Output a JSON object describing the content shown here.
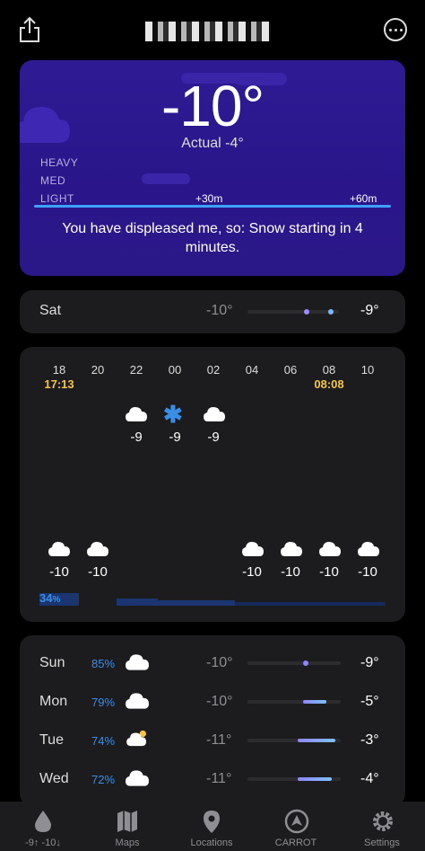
{
  "header": {
    "share_icon": "share-icon",
    "more_icon": "more-icon"
  },
  "hero": {
    "temperature": "-10°",
    "actual": "Actual -4°",
    "levels": [
      "HEAVY",
      "MED",
      "LIGHT"
    ],
    "ticks": [
      "+30m",
      "+60m"
    ],
    "message": "You have displeased me, so: Snow starting in 4 minutes.",
    "accent_color": "#3ea0ff",
    "background_color": "#2e1a93"
  },
  "today_row": {
    "day": "Sat",
    "low": "-10°",
    "high": "-9°"
  },
  "hourly": {
    "hours": [
      "18",
      "20",
      "22",
      "00",
      "02",
      "04",
      "06",
      "08",
      "10"
    ],
    "sunset": "17:13",
    "sunrise": "08:08",
    "temps": [
      "-10",
      "-10",
      "-9",
      "-9",
      "-9",
      "-10",
      "-10",
      "-10",
      "-10"
    ],
    "precip_chance": "34",
    "precip_unit": "%"
  },
  "daily": [
    {
      "day": "Sun",
      "pct": "85%",
      "low": "-10°",
      "high": "-9°",
      "icon": "cloud-icon"
    },
    {
      "day": "Mon",
      "pct": "79%",
      "low": "-10°",
      "high": "-5°",
      "icon": "cloud-icon"
    },
    {
      "day": "Tue",
      "pct": "74%",
      "low": "-11°",
      "high": "-3°",
      "icon": "partly-sunny-icon"
    },
    {
      "day": "Wed",
      "pct": "72%",
      "low": "-11°",
      "high": "-4°",
      "icon": "cloud-icon"
    }
  ],
  "tabs": [
    {
      "label": "-9↑ -10↓",
      "icon": "droplet-icon"
    },
    {
      "label": "Maps",
      "icon": "map-icon"
    },
    {
      "label": "Locations",
      "icon": "location-pin-icon"
    },
    {
      "label": "CARROT",
      "icon": "carrot-icon"
    },
    {
      "label": "Settings",
      "icon": "gear-icon"
    }
  ]
}
